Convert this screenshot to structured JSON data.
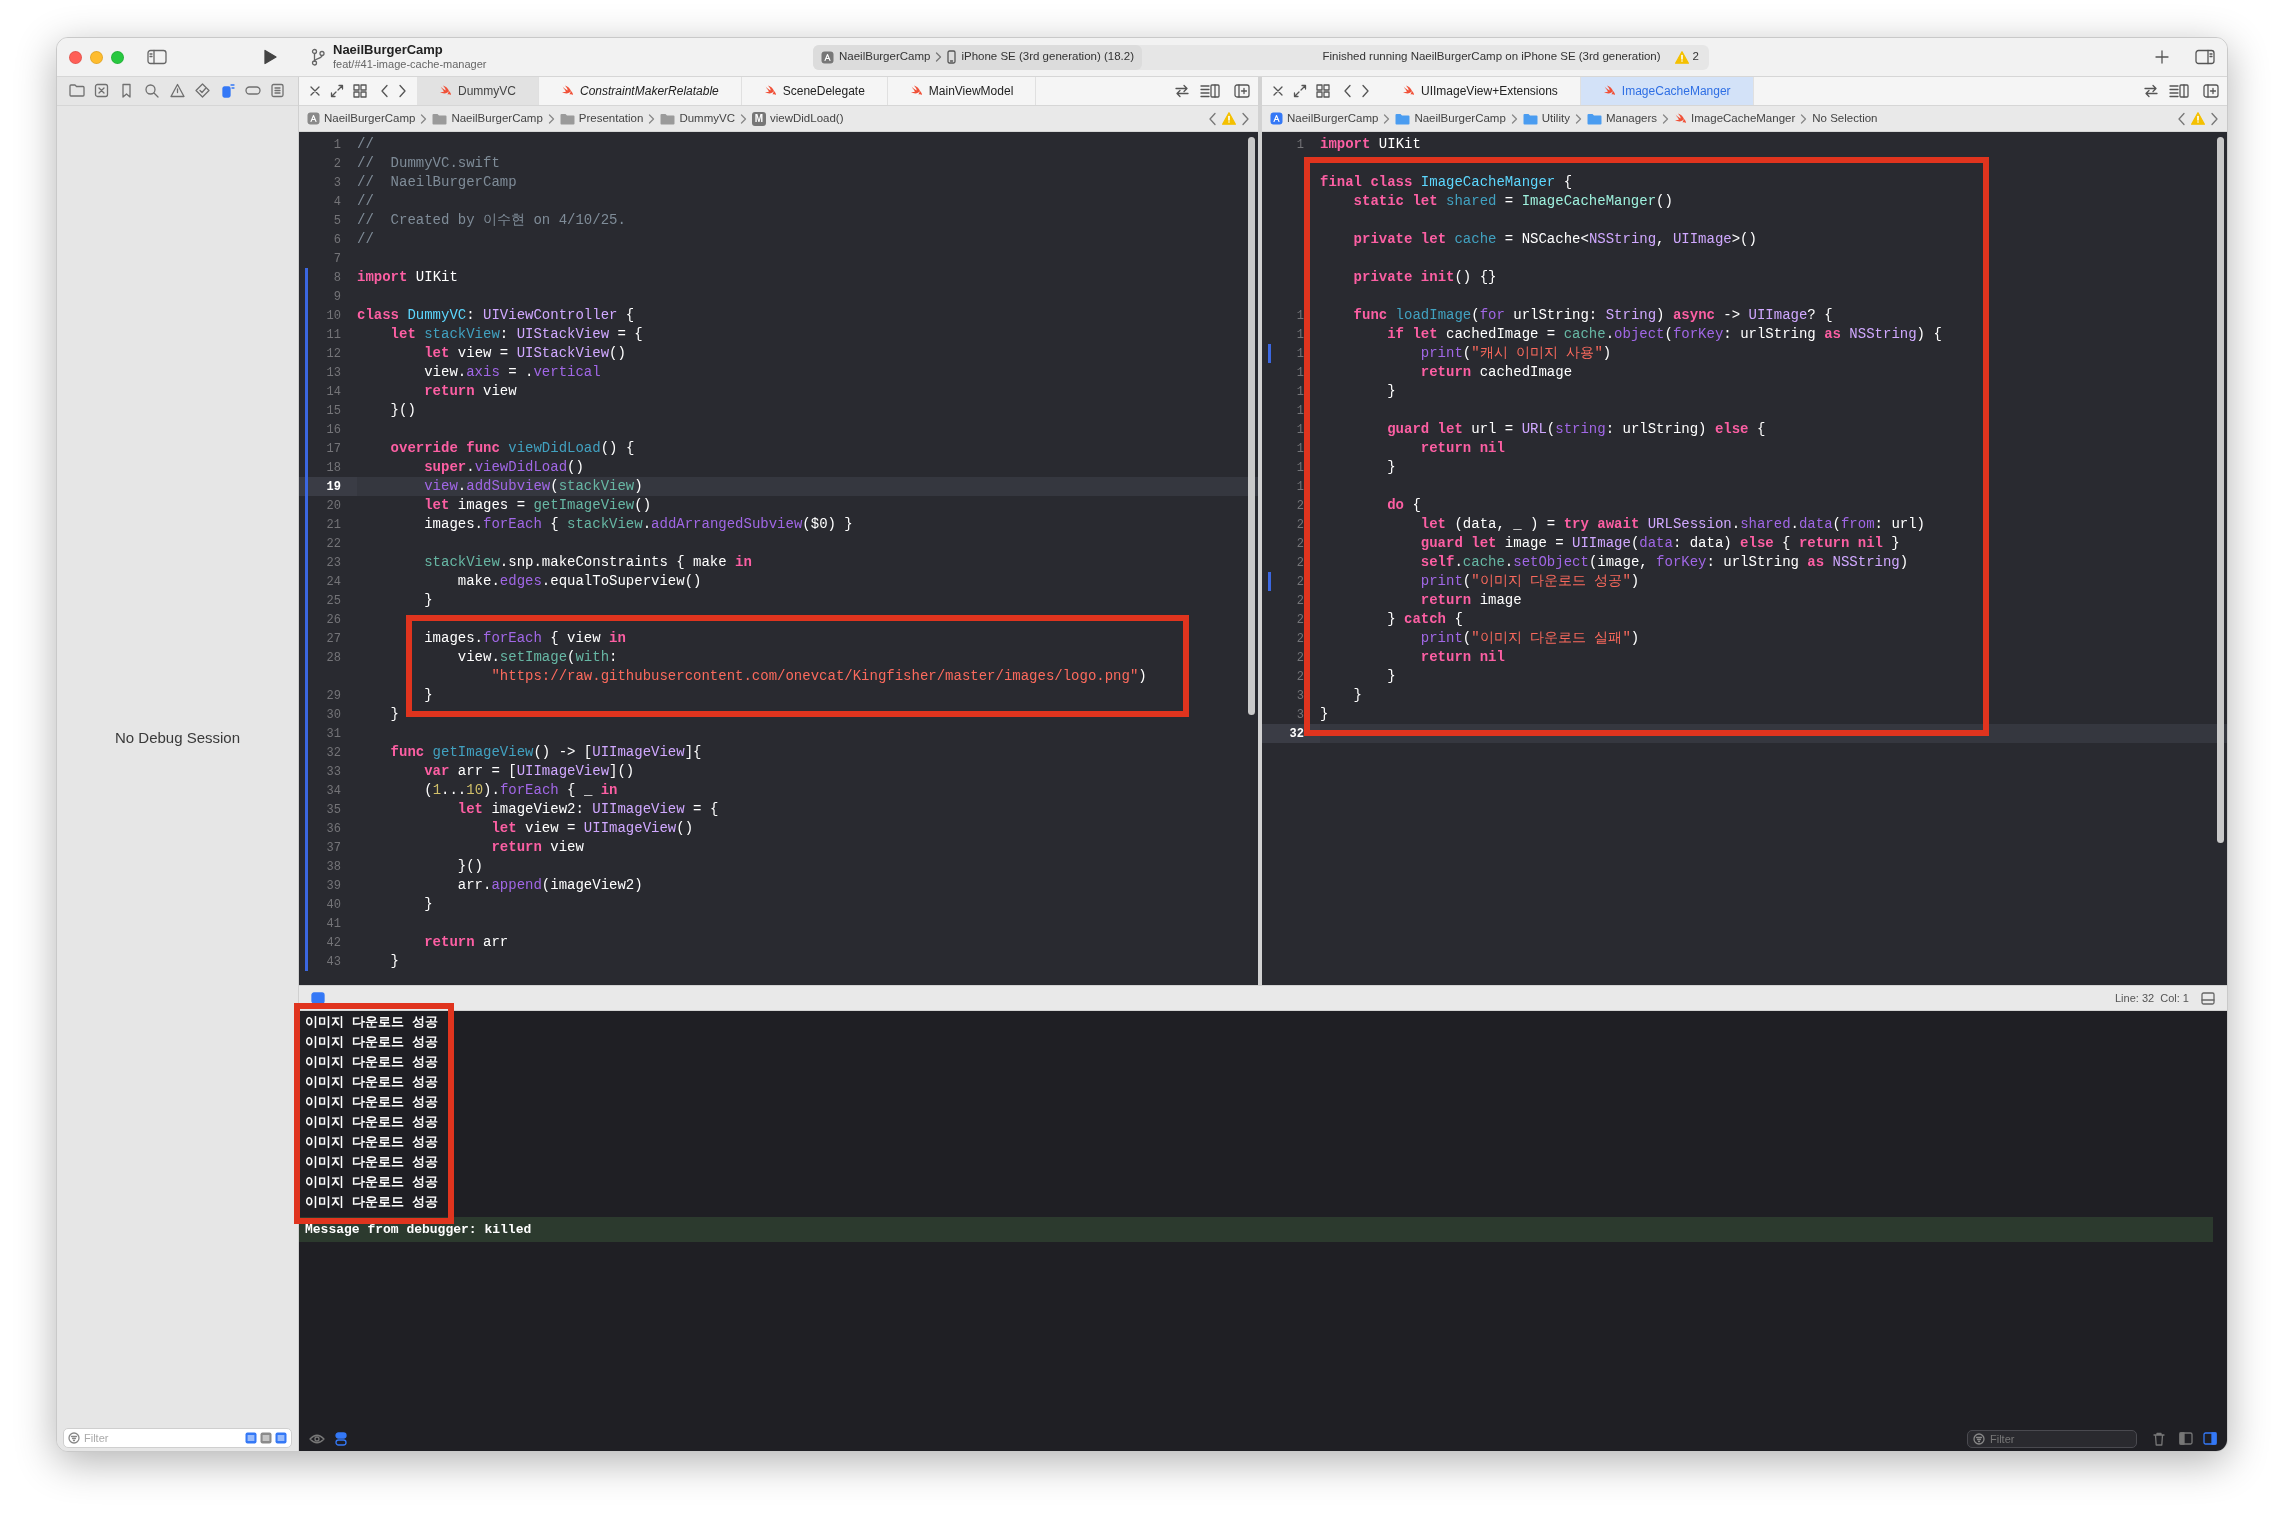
{
  "title_bar": {
    "project": "NaeilBurgerCamp",
    "branch": "feat/#41-image-cache-manager",
    "scheme": "NaeilBurgerCamp",
    "destination": "iPhone SE (3rd generation) (18.2)",
    "status": "Finished running NaeilBurgerCamp on iPhone SE (3rd generation)",
    "warning_count": "2"
  },
  "navigator": {
    "message": "No Debug Session",
    "filter_placeholder": "Filter"
  },
  "editors": [
    {
      "focused": false,
      "tabs": [
        {
          "label": "DummyVC",
          "selected": true,
          "preview": false
        },
        {
          "label": "ConstraintMakerRelatable",
          "selected": false,
          "preview": true
        },
        {
          "label": "SceneDelegate",
          "selected": false,
          "preview": false
        },
        {
          "label": "MainViewModel",
          "selected": false,
          "preview": false
        }
      ],
      "jump_bar": [
        {
          "label": "NaeilBurgerCamp",
          "kind": "project"
        },
        {
          "label": "NaeilBurgerCamp",
          "kind": "folder"
        },
        {
          "label": "Presentation",
          "kind": "folder"
        },
        {
          "label": "DummyVC",
          "kind": "folder"
        },
        {
          "label": "viewDidLoad()",
          "kind": "method",
          "badge": "M"
        }
      ],
      "lines": [
        {
          "number": "1",
          "changed": false,
          "current": false,
          "tokens": [
            {
              "kind": "cm",
              "text": "//"
            }
          ]
        },
        {
          "number": "2",
          "changed": false,
          "current": false,
          "tokens": [
            {
              "kind": "cm",
              "text": "//  DummyVC.swift"
            }
          ]
        },
        {
          "number": "3",
          "changed": false,
          "current": false,
          "tokens": [
            {
              "kind": "cm",
              "text": "//  NaeilBurgerCamp"
            }
          ]
        },
        {
          "number": "4",
          "changed": false,
          "current": false,
          "tokens": [
            {
              "kind": "cm",
              "text": "//"
            }
          ]
        },
        {
          "number": "5",
          "changed": false,
          "current": false,
          "tokens": [
            {
              "kind": "cm",
              "text": "//  Created by 이수현 on 4/10/25."
            }
          ]
        },
        {
          "number": "6",
          "changed": false,
          "current": false,
          "tokens": [
            {
              "kind": "cm",
              "text": "//"
            }
          ]
        },
        {
          "number": "7",
          "changed": false,
          "current": false
        },
        {
          "number": "8",
          "changed": true,
          "current": false,
          "tokens": [
            {
              "kind": "kw",
              "text": "import"
            },
            {
              "kind": "plain",
              "text": " UIKit"
            }
          ]
        },
        {
          "number": "9",
          "changed": true,
          "current": false
        },
        {
          "number": "10",
          "changed": true,
          "current": false,
          "tokens": [
            {
              "kind": "kw",
              "text": "class"
            },
            {
              "kind": "decl",
              "text": " DummyVC"
            },
            {
              "kind": "plain",
              "text": ": "
            },
            {
              "kind": "type",
              "text": "UIViewController"
            },
            {
              "kind": "plain",
              "text": " {"
            }
          ]
        },
        {
          "number": "11",
          "changed": true,
          "current": false,
          "tokens": [
            {
              "kind": "kw",
              "text": "    let"
            },
            {
              "kind": "decl2",
              "text": " stackView"
            },
            {
              "kind": "plain",
              "text": ": "
            },
            {
              "kind": "type",
              "text": "UIStackView"
            },
            {
              "kind": "plain",
              "text": " = {"
            }
          ]
        },
        {
          "number": "12",
          "changed": true,
          "current": false,
          "tokens": [
            {
              "kind": "kw",
              "text": "        let"
            },
            {
              "kind": "plain",
              "text": " view = "
            },
            {
              "kind": "type",
              "text": "UIStackView"
            },
            {
              "kind": "plain",
              "text": "()"
            }
          ]
        },
        {
          "number": "13",
          "changed": true,
          "current": false,
          "tokens": [
            {
              "kind": "plain",
              "text": "        view."
            },
            {
              "kind": "fn",
              "text": "axis"
            },
            {
              "kind": "plain",
              "text": " = ."
            },
            {
              "kind": "fn",
              "text": "vertical"
            }
          ]
        },
        {
          "number": "14",
          "changed": true,
          "current": false,
          "tokens": [
            {
              "kind": "kw",
              "text": "        return"
            },
            {
              "kind": "plain",
              "text": " view"
            }
          ]
        },
        {
          "number": "15",
          "changed": true,
          "current": false,
          "tokens": [
            {
              "kind": "plain",
              "text": "    }()"
            }
          ]
        },
        {
          "number": "16",
          "changed": true,
          "current": false
        },
        {
          "number": "17",
          "changed": true,
          "current": false,
          "tokens": [
            {
              "kind": "kw",
              "text": "    override"
            },
            {
              "kind": "kw",
              "text": " func"
            },
            {
              "kind": "decl2",
              "text": " viewDidLoad"
            },
            {
              "kind": "plain",
              "text": "() {"
            }
          ]
        },
        {
          "number": "18",
          "changed": true,
          "current": false,
          "tokens": [
            {
              "kind": "kw",
              "text": "        super"
            },
            {
              "kind": "plain",
              "text": "."
            },
            {
              "kind": "fn",
              "text": "viewDidLoad"
            },
            {
              "kind": "plain",
              "text": "()"
            }
          ]
        },
        {
          "number": "19",
          "changed": true,
          "current": true,
          "tokens": [
            {
              "kind": "fn",
              "text": "        view"
            },
            {
              "kind": "plain",
              "text": "."
            },
            {
              "kind": "fn",
              "text": "addSubview"
            },
            {
              "kind": "plain",
              "text": "("
            },
            {
              "kind": "pfunc",
              "text": "stackView"
            },
            {
              "kind": "plain",
              "text": ")"
            }
          ]
        },
        {
          "number": "20",
          "changed": true,
          "current": false,
          "tokens": [
            {
              "kind": "kw",
              "text": "        let"
            },
            {
              "kind": "plain",
              "text": " images = "
            },
            {
              "kind": "pfunc",
              "text": "getImageView"
            },
            {
              "kind": "plain",
              "text": "()"
            }
          ]
        },
        {
          "number": "21",
          "changed": true,
          "current": false,
          "tokens": [
            {
              "kind": "plain",
              "text": "        images."
            },
            {
              "kind": "fn",
              "text": "forEach"
            },
            {
              "kind": "plain",
              "text": " { "
            },
            {
              "kind": "pfunc",
              "text": "stackView"
            },
            {
              "kind": "plain",
              "text": "."
            },
            {
              "kind": "fn",
              "text": "addArrangedSubview"
            },
            {
              "kind": "plain",
              "text": "($0) }"
            }
          ]
        },
        {
          "number": "22",
          "changed": true,
          "current": false
        },
        {
          "number": "23",
          "changed": true,
          "current": false,
          "tokens": [
            {
              "kind": "pfunc",
              "text": "        stackView"
            },
            {
              "kind": "plain",
              "text": ".snp.makeConstraints { make "
            },
            {
              "kind": "kw",
              "text": "in"
            }
          ]
        },
        {
          "number": "24",
          "changed": true,
          "current": false,
          "tokens": [
            {
              "kind": "plain",
              "text": "            make."
            },
            {
              "kind": "fn",
              "text": "edges"
            },
            {
              "kind": "plain",
              "text": ".equalToSuperview()"
            }
          ]
        },
        {
          "number": "25",
          "changed": true,
          "current": false,
          "tokens": [
            {
              "kind": "plain",
              "text": "        }"
            }
          ]
        },
        {
          "number": "26",
          "changed": true,
          "current": false
        },
        {
          "number": "27",
          "changed": true,
          "current": false,
          "tokens": [
            {
              "kind": "plain",
              "text": "        images."
            },
            {
              "kind": "fn",
              "text": "forEach"
            },
            {
              "kind": "plain",
              "text": " { view "
            },
            {
              "kind": "kw",
              "text": "in"
            }
          ]
        },
        {
          "number": "28",
          "changed": true,
          "current": false,
          "tokens": [
            {
              "kind": "plain",
              "text": "            view."
            },
            {
              "kind": "pfunc",
              "text": "setImage"
            },
            {
              "kind": "plain",
              "text": "("
            },
            {
              "kind": "pfunc",
              "text": "with"
            },
            {
              "kind": "plain",
              "text": ":"
            }
          ]
        },
        {
          "changed": true,
          "current": false,
          "tokens": [
            {
              "kind": "str",
              "text": "                \"https://raw.githubusercontent.com/onevcat/Kingfisher/master/images/logo.png\""
            },
            {
              "kind": "plain",
              "text": ")"
            }
          ]
        },
        {
          "number": "29",
          "changed": true,
          "current": false,
          "tokens": [
            {
              "kind": "plain",
              "text": "        }"
            }
          ]
        },
        {
          "number": "30",
          "changed": true,
          "current": false,
          "tokens": [
            {
              "kind": "plain",
              "text": "    }"
            }
          ]
        },
        {
          "number": "31",
          "changed": true,
          "current": false
        },
        {
          "number": "32",
          "changed": true,
          "current": false,
          "tokens": [
            {
              "kind": "kw",
              "text": "    func"
            },
            {
              "kind": "decl2",
              "text": " getImageView"
            },
            {
              "kind": "plain",
              "text": "() -> ["
            },
            {
              "kind": "type",
              "text": "UIImageView"
            },
            {
              "kind": "plain",
              "text": "]{"
            }
          ]
        },
        {
          "number": "33",
          "changed": true,
          "current": false,
          "tokens": [
            {
              "kind": "kw",
              "text": "        var"
            },
            {
              "kind": "plain",
              "text": " arr = ["
            },
            {
              "kind": "type",
              "text": "UIImageView"
            },
            {
              "kind": "plain",
              "text": "]()"
            }
          ]
        },
        {
          "number": "34",
          "changed": true,
          "current": false,
          "tokens": [
            {
              "kind": "plain",
              "text": "        ("
            },
            {
              "kind": "num",
              "text": "1"
            },
            {
              "kind": "plain",
              "text": "..."
            },
            {
              "kind": "num",
              "text": "10"
            },
            {
              "kind": "plain",
              "text": ")."
            },
            {
              "kind": "fn",
              "text": "forEach"
            },
            {
              "kind": "plain",
              "text": " { _ "
            },
            {
              "kind": "kw",
              "text": "in"
            }
          ]
        },
        {
          "number": "35",
          "changed": true,
          "current": false,
          "tokens": [
            {
              "kind": "kw",
              "text": "            let"
            },
            {
              "kind": "plain",
              "text": " imageView2: "
            },
            {
              "kind": "type",
              "text": "UIImageView"
            },
            {
              "kind": "plain",
              "text": " = {"
            }
          ]
        },
        {
          "number": "36",
          "changed": true,
          "current": false,
          "tokens": [
            {
              "kind": "kw",
              "text": "                let"
            },
            {
              "kind": "plain",
              "text": " view = "
            },
            {
              "kind": "type",
              "text": "UIImageView"
            },
            {
              "kind": "plain",
              "text": "()"
            }
          ]
        },
        {
          "number": "37",
          "changed": true,
          "current": false,
          "tokens": [
            {
              "kind": "kw",
              "text": "                return"
            },
            {
              "kind": "plain",
              "text": " view"
            }
          ]
        },
        {
          "number": "38",
          "changed": true,
          "current": false,
          "tokens": [
            {
              "kind": "plain",
              "text": "            }()"
            }
          ]
        },
        {
          "number": "39",
          "changed": true,
          "current": false,
          "tokens": [
            {
              "kind": "plain",
              "text": "            arr."
            },
            {
              "kind": "fn",
              "text": "append"
            },
            {
              "kind": "plain",
              "text": "(imageView2)"
            }
          ]
        },
        {
          "number": "40",
          "changed": true,
          "current": false,
          "tokens": [
            {
              "kind": "plain",
              "text": "        }"
            }
          ]
        },
        {
          "number": "41",
          "changed": true,
          "current": false
        },
        {
          "number": "42",
          "changed": true,
          "current": false,
          "tokens": [
            {
              "kind": "kw",
              "text": "        return"
            },
            {
              "kind": "plain",
              "text": " arr"
            }
          ]
        },
        {
          "number": "43",
          "changed": true,
          "current": false,
          "tokens": [
            {
              "kind": "plain",
              "text": "    }"
            }
          ]
        }
      ]
    },
    {
      "focused": true,
      "tabs": [
        {
          "label": "UIImageView+Extensions",
          "selected": false,
          "preview": false
        },
        {
          "label": "ImageCacheManger",
          "selected": true,
          "preview": false
        }
      ],
      "jump_bar": [
        {
          "label": "NaeilBurgerCamp",
          "kind": "project"
        },
        {
          "label": "NaeilBurgerCamp",
          "kind": "folder"
        },
        {
          "label": "Utility",
          "kind": "folder"
        },
        {
          "label": "Managers",
          "kind": "folder"
        },
        {
          "label": "ImageCacheManger",
          "kind": "swift"
        },
        {
          "label": "No Selection",
          "kind": "text"
        }
      ],
      "lines": [
        {
          "number": "1",
          "changed": false,
          "current": false,
          "tokens": [
            {
              "kind": "kw",
              "text": "import"
            },
            {
              "kind": "plain",
              "text": " UIKit"
            }
          ]
        },
        {
          "changed": false,
          "current": false
        },
        {
          "changed": false,
          "current": false,
          "tokens": [
            {
              "kind": "kw",
              "text": "final"
            },
            {
              "kind": "kw",
              "text": " class"
            },
            {
              "kind": "decl",
              "text": " ImageCacheManger"
            },
            {
              "kind": "plain",
              "text": " {"
            }
          ]
        },
        {
          "changed": false,
          "current": false,
          "tokens": [
            {
              "kind": "kw",
              "text": "    static"
            },
            {
              "kind": "kw",
              "text": " let"
            },
            {
              "kind": "decl2",
              "text": " shared"
            },
            {
              "kind": "plain",
              "text": " = "
            },
            {
              "kind": "ptype",
              "text": "ImageCacheManger"
            },
            {
              "kind": "plain",
              "text": "()"
            }
          ]
        },
        {
          "changed": false,
          "current": false
        },
        {
          "changed": false,
          "current": false,
          "tokens": [
            {
              "kind": "kw",
              "text": "    private"
            },
            {
              "kind": "kw",
              "text": " let"
            },
            {
              "kind": "decl2",
              "text": " cache"
            },
            {
              "kind": "plain",
              "text": " = NSCache<"
            },
            {
              "kind": "type",
              "text": "NSString"
            },
            {
              "kind": "plain",
              "text": ", "
            },
            {
              "kind": "type",
              "text": "UIImage"
            },
            {
              "kind": "plain",
              "text": ">()"
            }
          ]
        },
        {
          "changed": false,
          "current": false
        },
        {
          "changed": false,
          "current": false,
          "tokens": [
            {
              "kind": "kw",
              "text": "    private"
            },
            {
              "kind": "kw",
              "text": " init"
            },
            {
              "kind": "plain",
              "text": "() {}"
            }
          ]
        },
        {
          "changed": false,
          "current": false
        },
        {
          "number": "1",
          "changed": false,
          "current": false,
          "tokens": [
            {
              "kind": "kw",
              "text": "    func"
            },
            {
              "kind": "decl2",
              "text": " loadImage"
            },
            {
              "kind": "plain",
              "text": "("
            },
            {
              "kind": "fn",
              "text": "for"
            },
            {
              "kind": "plain",
              "text": " urlString: "
            },
            {
              "kind": "type",
              "text": "String"
            },
            {
              "kind": "plain",
              "text": ") "
            },
            {
              "kind": "kw",
              "text": "async"
            },
            {
              "kind": "plain",
              "text": " -> "
            },
            {
              "kind": "type",
              "text": "UIImage"
            },
            {
              "kind": "plain",
              "text": "? {"
            }
          ]
        },
        {
          "number": "1",
          "changed": false,
          "current": false,
          "tokens": [
            {
              "kind": "kw",
              "text": "        if"
            },
            {
              "kind": "kw",
              "text": " let"
            },
            {
              "kind": "plain",
              "text": " cachedImage = "
            },
            {
              "kind": "pfunc",
              "text": "cache"
            },
            {
              "kind": "plain",
              "text": "."
            },
            {
              "kind": "fn",
              "text": "object"
            },
            {
              "kind": "plain",
              "text": "("
            },
            {
              "kind": "fn",
              "text": "forKey"
            },
            {
              "kind": "plain",
              "text": ": urlString "
            },
            {
              "kind": "kw",
              "text": "as"
            },
            {
              "kind": "type",
              "text": " NSString"
            },
            {
              "kind": "plain",
              "text": ") {"
            }
          ]
        },
        {
          "number": "1",
          "changed": true,
          "current": false,
          "tokens": [
            {
              "kind": "fn",
              "text": "            print"
            },
            {
              "kind": "plain",
              "text": "("
            },
            {
              "kind": "str",
              "text": "\"캐시 이미지 사용\""
            },
            {
              "kind": "plain",
              "text": ")"
            }
          ]
        },
        {
          "number": "1",
          "changed": false,
          "current": false,
          "tokens": [
            {
              "kind": "kw",
              "text": "            return"
            },
            {
              "kind": "plain",
              "text": " cachedImage"
            }
          ]
        },
        {
          "number": "1",
          "changed": false,
          "current": false,
          "tokens": [
            {
              "kind": "plain",
              "text": "        }"
            }
          ]
        },
        {
          "number": "1",
          "changed": false,
          "current": false
        },
        {
          "number": "1",
          "changed": false,
          "current": false,
          "tokens": [
            {
              "kind": "kw",
              "text": "        guard"
            },
            {
              "kind": "kw",
              "text": " let"
            },
            {
              "kind": "plain",
              "text": " url = "
            },
            {
              "kind": "type",
              "text": "URL"
            },
            {
              "kind": "plain",
              "text": "("
            },
            {
              "kind": "fn",
              "text": "string"
            },
            {
              "kind": "plain",
              "text": ": urlString) "
            },
            {
              "kind": "kw",
              "text": "else"
            },
            {
              "kind": "plain",
              "text": " {"
            }
          ]
        },
        {
          "number": "1",
          "changed": false,
          "current": false,
          "tokens": [
            {
              "kind": "kw",
              "text": "            return"
            },
            {
              "kind": "kw",
              "text": " nil"
            }
          ]
        },
        {
          "number": "1",
          "changed": false,
          "current": false,
          "tokens": [
            {
              "kind": "plain",
              "text": "        }"
            }
          ]
        },
        {
          "number": "1",
          "changed": false,
          "current": false
        },
        {
          "number": "2",
          "changed": false,
          "current": false,
          "tokens": [
            {
              "kind": "kw",
              "text": "        do"
            },
            {
              "kind": "plain",
              "text": " {"
            }
          ]
        },
        {
          "number": "2",
          "changed": false,
          "current": false,
          "tokens": [
            {
              "kind": "kw",
              "text": "            let"
            },
            {
              "kind": "plain",
              "text": " (data, _ ) = "
            },
            {
              "kind": "kw",
              "text": "try"
            },
            {
              "kind": "kw",
              "text": " await"
            },
            {
              "kind": "type",
              "text": " URLSession"
            },
            {
              "kind": "plain",
              "text": "."
            },
            {
              "kind": "fn",
              "text": "shared"
            },
            {
              "kind": "plain",
              "text": "."
            },
            {
              "kind": "fn",
              "text": "data"
            },
            {
              "kind": "plain",
              "text": "("
            },
            {
              "kind": "fn",
              "text": "from"
            },
            {
              "kind": "plain",
              "text": ": url)"
            }
          ]
        },
        {
          "number": "2",
          "changed": false,
          "current": false,
          "tokens": [
            {
              "kind": "kw",
              "text": "            guard"
            },
            {
              "kind": "kw",
              "text": " let"
            },
            {
              "kind": "plain",
              "text": " image = "
            },
            {
              "kind": "type",
              "text": "UIImage"
            },
            {
              "kind": "plain",
              "text": "("
            },
            {
              "kind": "fn",
              "text": "data"
            },
            {
              "kind": "plain",
              "text": ": data) "
            },
            {
              "kind": "kw",
              "text": "else"
            },
            {
              "kind": "plain",
              "text": " { "
            },
            {
              "kind": "kw",
              "text": "return"
            },
            {
              "kind": "kw",
              "text": " nil"
            },
            {
              "kind": "plain",
              "text": " }"
            }
          ]
        },
        {
          "number": "2",
          "changed": false,
          "current": false,
          "tokens": [
            {
              "kind": "kw",
              "text": "            self"
            },
            {
              "kind": "plain",
              "text": "."
            },
            {
              "kind": "pfunc",
              "text": "cache"
            },
            {
              "kind": "plain",
              "text": "."
            },
            {
              "kind": "fn",
              "text": "setObject"
            },
            {
              "kind": "plain",
              "text": "(image, "
            },
            {
              "kind": "fn",
              "text": "forKey"
            },
            {
              "kind": "plain",
              "text": ": urlString "
            },
            {
              "kind": "kw",
              "text": "as"
            },
            {
              "kind": "type",
              "text": " NSString"
            },
            {
              "kind": "plain",
              "text": ")"
            }
          ]
        },
        {
          "number": "2",
          "changed": true,
          "current": false,
          "tokens": [
            {
              "kind": "fn",
              "text": "            print"
            },
            {
              "kind": "plain",
              "text": "("
            },
            {
              "kind": "str",
              "text": "\"이미지 다운로드 성공\""
            },
            {
              "kind": "plain",
              "text": ")"
            }
          ]
        },
        {
          "number": "2",
          "changed": false,
          "current": false,
          "tokens": [
            {
              "kind": "kw",
              "text": "            return"
            },
            {
              "kind": "plain",
              "text": " image"
            }
          ]
        },
        {
          "number": "2",
          "changed": false,
          "current": false,
          "tokens": [
            {
              "kind": "plain",
              "text": "        } "
            },
            {
              "kind": "kw",
              "text": "catch"
            },
            {
              "kind": "plain",
              "text": " {"
            }
          ]
        },
        {
          "number": "2",
          "changed": false,
          "current": false,
          "tokens": [
            {
              "kind": "fn",
              "text": "            print"
            },
            {
              "kind": "plain",
              "text": "("
            },
            {
              "kind": "str",
              "text": "\"이미지 다운로드 실패\""
            },
            {
              "kind": "plain",
              "text": ")"
            }
          ]
        },
        {
          "number": "2",
          "changed": false,
          "current": false,
          "tokens": [
            {
              "kind": "kw",
              "text": "            return"
            },
            {
              "kind": "kw",
              "text": " nil"
            }
          ]
        },
        {
          "number": "2",
          "changed": false,
          "current": false,
          "tokens": [
            {
              "kind": "plain",
              "text": "        }"
            }
          ]
        },
        {
          "number": "3",
          "changed": false,
          "current": false,
          "tokens": [
            {
              "kind": "plain",
              "text": "    }"
            }
          ]
        },
        {
          "number": "3",
          "changed": false,
          "current": false,
          "tokens": [
            {
              "kind": "plain",
              "text": "}"
            }
          ]
        },
        {
          "number": "32",
          "changed": false,
          "current": true
        }
      ]
    }
  ],
  "debug_bar": {
    "position": "Line: 32  Col: 1"
  },
  "console": {
    "lines": [
      "이미지 다운로드 성공",
      "이미지 다운로드 성공",
      "이미지 다운로드 성공",
      "이미지 다운로드 성공",
      "이미지 다운로드 성공",
      "이미지 다운로드 성공",
      "이미지 다운로드 성공",
      "이미지 다운로드 성공",
      "이미지 다운로드 성공",
      "이미지 다운로드 성공"
    ],
    "debugger_message": "Message from debugger: killed",
    "filter_placeholder": "Filter"
  }
}
